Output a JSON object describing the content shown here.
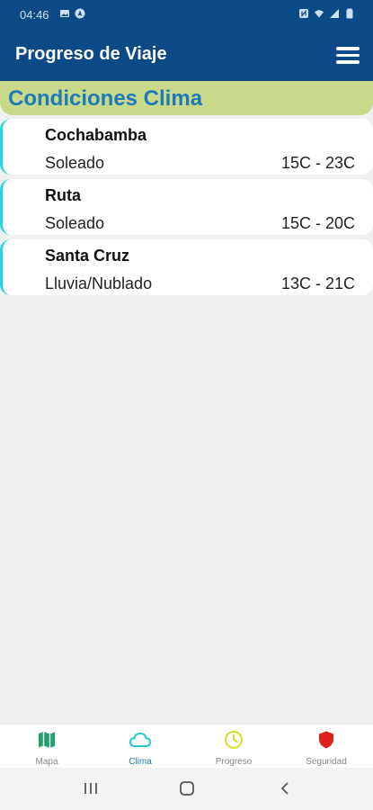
{
  "status_bar": {
    "time": "04:46",
    "left_icons": [
      "image-icon",
      "navigation-icon"
    ],
    "right_icons": [
      "nfc-icon",
      "wifi-icon",
      "signal-icon",
      "battery-icon"
    ]
  },
  "app_bar": {
    "title": "Progreso de Viaje",
    "menu_icon": "menu-icon"
  },
  "section": {
    "title": "Condiciones Clima"
  },
  "weather": [
    {
      "city": "Cochabamba",
      "condition": "Soleado",
      "range": "15C - 23C"
    },
    {
      "city": "Ruta",
      "condition": "Soleado",
      "range": "15C - 20C"
    },
    {
      "city": "Santa Cruz",
      "condition": "Lluvia/Nublado",
      "range": "13C - 21C"
    }
  ],
  "bottom_nav": {
    "items": [
      {
        "label": "Mapa",
        "icon": "map-icon",
        "color": "#1fa36a"
      },
      {
        "label": "Clima",
        "icon": "cloud-icon",
        "color": "#23c9d8",
        "active": true
      },
      {
        "label": "Progreso",
        "icon": "clock-icon",
        "color": "#d6df2a"
      },
      {
        "label": "Seguridad",
        "icon": "shield-icon",
        "color": "#e0201c"
      }
    ]
  },
  "colors": {
    "primary": "#0b4a86",
    "section_bg": "#c8d98a",
    "section_text": "#1d7ab8",
    "card_accent": "#23d5e0",
    "background": "#f0f0f0"
  }
}
